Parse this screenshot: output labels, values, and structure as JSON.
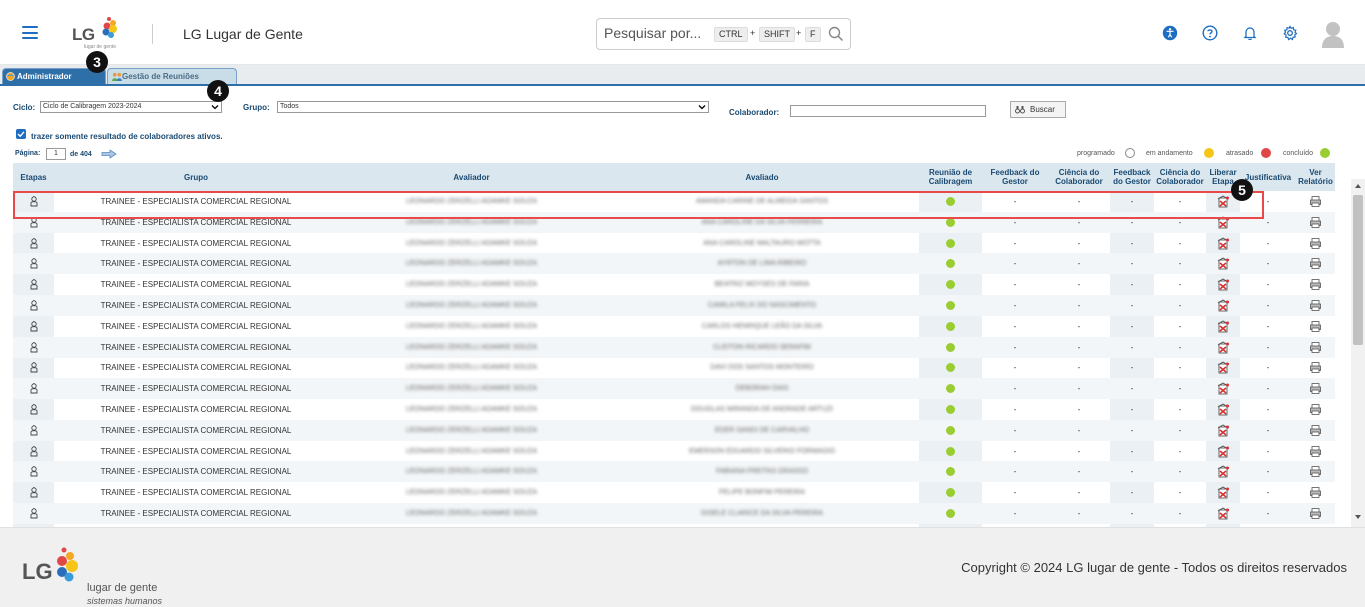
{
  "header": {
    "app_title": "LG Lugar de Gente",
    "logo_text": "LG",
    "logo_small": "lugar de gente",
    "search_placeholder": "Pesquisar por...",
    "shortcut_keys": [
      "CTRL",
      "SHIFT",
      "F"
    ],
    "icons": [
      "accessibility-icon",
      "help-icon",
      "bell-icon",
      "gear-icon",
      "user-avatar-icon"
    ]
  },
  "tabs": [
    {
      "label": "Administrador",
      "active": true
    },
    {
      "label": "Gestão de Reuniões",
      "active": false
    }
  ],
  "filters": {
    "ciclo_label": "Ciclo:",
    "ciclo_value": "Ciclo de Calibragem 2023-2024",
    "grupo_label": "Grupo:",
    "grupo_value": "Todos",
    "colaborador_label": "Colaborador:",
    "colaborador_value": "",
    "buscar_label": "Buscar",
    "checkbox_label": "trazer somente resultado de colaboradores ativos.",
    "checkbox_checked": true
  },
  "pagination": {
    "label": "Página:",
    "current": "1",
    "total_text": "de 404"
  },
  "legend": [
    {
      "label": "programado",
      "color": "#ffffff"
    },
    {
      "label": "em andamento",
      "color": "#f5c518"
    },
    {
      "label": "atrasado",
      "color": "#e04848"
    },
    {
      "label": "concluído",
      "color": "#9acd32"
    }
  ],
  "table": {
    "headers": [
      "Etapas",
      "Grupo",
      "Avaliador",
      "Avaliado",
      "Reunião de Calibragem",
      "Feedback do Gestor",
      "Ciência do Colaborador",
      "Feedback do Gestor",
      "Ciência do Colaborador",
      "Liberar Etapa",
      "Justificativa",
      "Ver Relatório"
    ],
    "rows": [
      {
        "grupo": "TRAINEE - ESPECIALISTA COMERCIAL REGIONAL",
        "avaliador": "LEONARDO ZERZELLI ADAMKE SOUZA",
        "avaliado": "AMANDA CARINE DE ALMEIDA SANTOS",
        "fg": "-",
        "cc": "-",
        "fg2": "-",
        "cc2": "-",
        "just": "-"
      },
      {
        "grupo": "TRAINEE - ESPECIALISTA COMERCIAL REGIONAL",
        "avaliador": "LEONARDO ZERZELLI ADAMKE SOUZA",
        "avaliado": "ANA CAROLINE DA SILVA FERREIRA",
        "fg": "-",
        "cc": "-",
        "fg2": "-",
        "cc2": "-",
        "just": "-"
      },
      {
        "grupo": "TRAINEE - ESPECIALISTA COMERCIAL REGIONAL",
        "avaliador": "LEONARDO ZERZELLI ADAMKE SOUZA",
        "avaliado": "ANA CAROLINE MALTAURO MOTTA",
        "fg": "-",
        "cc": "-",
        "fg2": "-",
        "cc2": "-",
        "just": "-"
      },
      {
        "grupo": "TRAINEE - ESPECIALISTA COMERCIAL REGIONAL",
        "avaliador": "LEONARDO ZERZELLI ADAMKE SOUZA",
        "avaliado": "AYRTON DE LIMA RIBEIRO",
        "fg": "-",
        "cc": "-",
        "fg2": "-",
        "cc2": "-",
        "just": "-"
      },
      {
        "grupo": "TRAINEE - ESPECIALISTA COMERCIAL REGIONAL",
        "avaliador": "LEONARDO ZERZELLI ADAMKE SOUZA",
        "avaliado": "BEATRIZ MOYSES DE FARIA",
        "fg": "-",
        "cc": "-",
        "fg2": "-",
        "cc2": "-",
        "just": "-"
      },
      {
        "grupo": "TRAINEE - ESPECIALISTA COMERCIAL REGIONAL",
        "avaliador": "LEONARDO ZERZELLI ADAMKE SOUZA",
        "avaliado": "CAMILA FELIX DO NASCIMENTO",
        "fg": "-",
        "cc": "-",
        "fg2": "-",
        "cc2": "-",
        "just": "-"
      },
      {
        "grupo": "TRAINEE - ESPECIALISTA COMERCIAL REGIONAL",
        "avaliador": "LEONARDO ZERZELLI ADAMKE SOUZA",
        "avaliado": "CARLOS HENRIQUE LEÃO DA SILVA",
        "fg": "-",
        "cc": "-",
        "fg2": "-",
        "cc2": "-",
        "just": "-"
      },
      {
        "grupo": "TRAINEE - ESPECIALISTA COMERCIAL REGIONAL",
        "avaliador": "LEONARDO ZERZELLI ADAMKE SOUZA",
        "avaliado": "CLEITON RICARDO SERAFIM",
        "fg": "-",
        "cc": "-",
        "fg2": "-",
        "cc2": "-",
        "just": "-"
      },
      {
        "grupo": "TRAINEE - ESPECIALISTA COMERCIAL REGIONAL",
        "avaliador": "LEONARDO ZERZELLI ADAMKE SOUZA",
        "avaliado": "DAVI DOS SANTOS MONTEIRO",
        "fg": "-",
        "cc": "-",
        "fg2": "-",
        "cc2": "-",
        "just": "-"
      },
      {
        "grupo": "TRAINEE - ESPECIALISTA COMERCIAL REGIONAL",
        "avaliador": "LEONARDO ZERZELLI ADAMKE SOUZA",
        "avaliado": "DEBORAH DIAS",
        "fg": "-",
        "cc": "-",
        "fg2": "-",
        "cc2": "-",
        "just": "-"
      },
      {
        "grupo": "TRAINEE - ESPECIALISTA COMERCIAL REGIONAL",
        "avaliador": "LEONARDO ZERZELLI ADAMKE SOUZA",
        "avaliado": "DOUGLAS MIRANDA DE ANDRADE ARTUZI",
        "fg": "-",
        "cc": "-",
        "fg2": "-",
        "cc2": "-",
        "just": "-"
      },
      {
        "grupo": "TRAINEE - ESPECIALISTA COMERCIAL REGIONAL",
        "avaliador": "LEONARDO ZERZELLI ADAMKE SOUZA",
        "avaliado": "EDER SANDI DE CARVALHO",
        "fg": "-",
        "cc": "-",
        "fg2": "-",
        "cc2": "-",
        "just": "-"
      },
      {
        "grupo": "TRAINEE - ESPECIALISTA COMERCIAL REGIONAL",
        "avaliador": "LEONARDO ZERZELLI ADAMKE SOUZA",
        "avaliado": "EMERSON EDUARDO SILVERIO FORMAGIO",
        "fg": "-",
        "cc": "-",
        "fg2": "-",
        "cc2": "-",
        "just": "-"
      },
      {
        "grupo": "TRAINEE - ESPECIALISTA COMERCIAL REGIONAL",
        "avaliador": "LEONARDO ZERZELLI ADAMKE SOUZA",
        "avaliado": "FABIANA FREITAS GRASSO",
        "fg": "-",
        "cc": "-",
        "fg2": "-",
        "cc2": "-",
        "just": "-"
      },
      {
        "grupo": "TRAINEE - ESPECIALISTA COMERCIAL REGIONAL",
        "avaliador": "LEONARDO ZERZELLI ADAMKE SOUZA",
        "avaliado": "FELIPE BONFIM PEREIRA",
        "fg": "-",
        "cc": "-",
        "fg2": "-",
        "cc2": "-",
        "just": "-"
      },
      {
        "grupo": "TRAINEE - ESPECIALISTA COMERCIAL REGIONAL",
        "avaliador": "LEONARDO ZERZELLI ADAMKE SOUZA",
        "avaliado": "GISELE CLARICE DA SILVA PEREIRA",
        "fg": "-",
        "cc": "-",
        "fg2": "-",
        "cc2": "-",
        "just": "-"
      }
    ]
  },
  "markers": [
    "3",
    "4",
    "5"
  ],
  "footer": {
    "logo_text": "LG",
    "brand": "lugar de gente",
    "sub": "sistemas humanos",
    "copyright": "Copyright © 2024 LG lugar de gente - Todos os direitos reservados"
  }
}
